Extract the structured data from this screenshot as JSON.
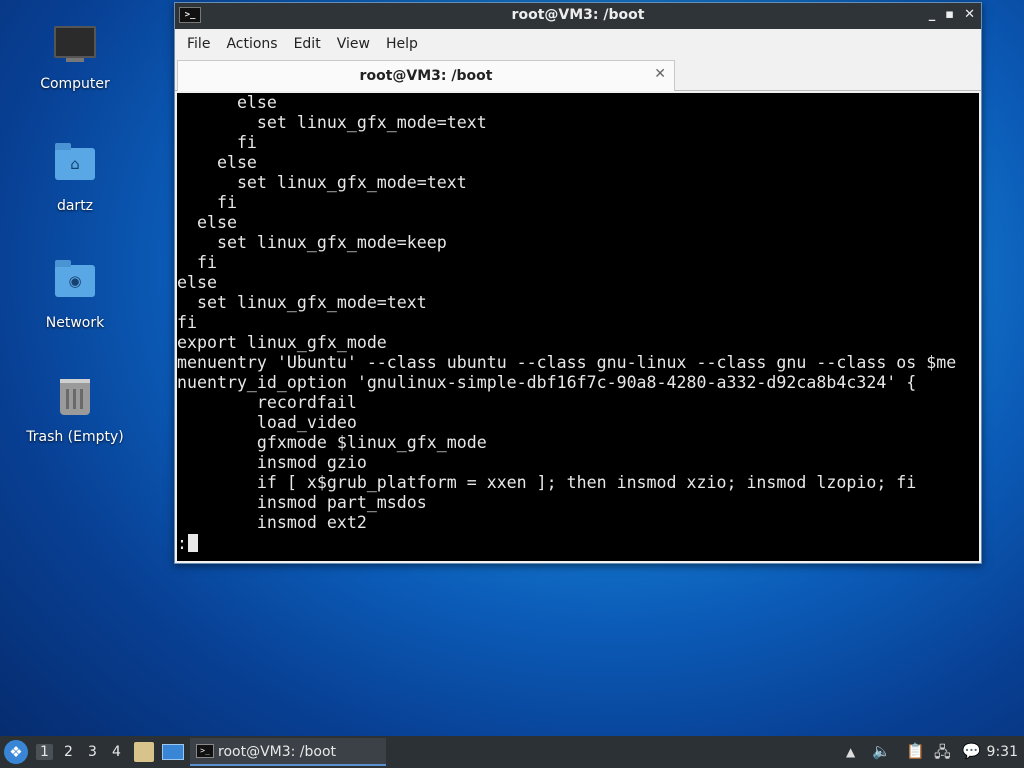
{
  "desktop": {
    "icons": [
      {
        "label": "Computer",
        "icon": "computer-icon"
      },
      {
        "label": "dartz",
        "icon": "home-folder-icon"
      },
      {
        "label": "Network",
        "icon": "network-folder-icon"
      },
      {
        "label": "Trash (Empty)",
        "icon": "trash-icon"
      }
    ]
  },
  "window": {
    "title": "root@VM3: /boot",
    "app_icon_glyph": ">_",
    "controls": {
      "minimize": "_",
      "maximize": "▪",
      "close": "✕"
    },
    "menu": [
      "File",
      "Actions",
      "Edit",
      "View",
      "Help"
    ],
    "tab": {
      "title": "root@VM3: /boot",
      "close": "✕"
    },
    "terminal": {
      "lines": "      else\n        set linux_gfx_mode=text\n      fi\n    else\n      set linux_gfx_mode=text\n    fi\n  else\n    set linux_gfx_mode=keep\n  fi\nelse\n  set linux_gfx_mode=text\nfi\nexport linux_gfx_mode\nmenuentry 'Ubuntu' --class ubuntu --class gnu-linux --class gnu --class os $me\nnuentry_id_option 'gnulinux-simple-dbf16f7c-90a8-4280-a332-d92ca8b4c324' {\n        recordfail\n        load_video\n        gfxmode $linux_gfx_mode\n        insmod gzio\n        if [ x$grub_platform = xxen ]; then insmod xzio; insmod lzopio; fi\n        insmod part_msdos\n        insmod ext2",
      "prompt": ":"
    }
  },
  "taskbar": {
    "start_glyph": "❖",
    "workspaces": [
      "1",
      "2",
      "3",
      "4"
    ],
    "active_workspace": "1",
    "task_label": "root@VM3: /boot",
    "task_icon_glyph": ">_",
    "tray": {
      "up_arrow": "▲",
      "volume": "🔈",
      "clipboard": "📋",
      "network": "🖧",
      "updates": "💬"
    },
    "clock": "9:31"
  }
}
